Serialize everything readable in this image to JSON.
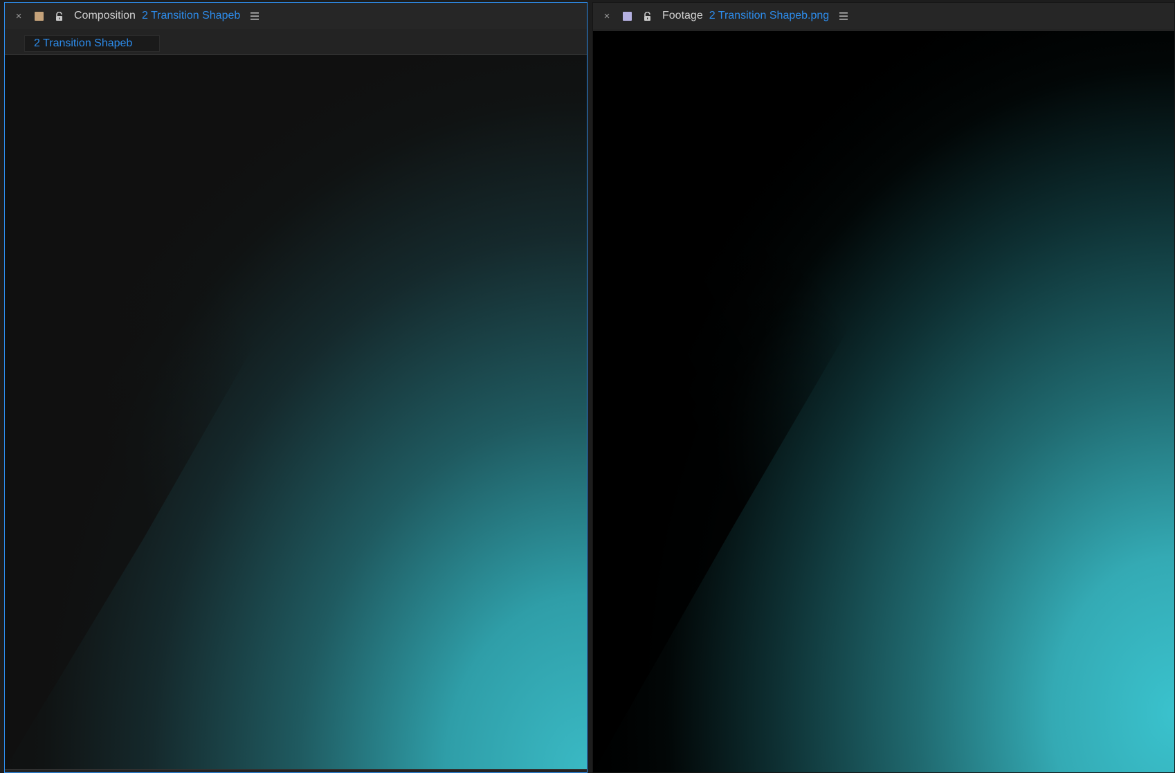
{
  "composition_panel": {
    "panel_type": "Composition",
    "name": "2 Transition Shapeb",
    "label_color": "#c4a27a",
    "breadcrumb": "2 Transition Shapeb",
    "viewer_background": "#101010"
  },
  "footage_panel": {
    "panel_type": "Footage",
    "name": "2 Transition Shapeb.png",
    "label_color": "#b4b0e0",
    "viewer_background": "#000000"
  },
  "icons": {
    "close": "close-icon",
    "lock": "lock-icon",
    "menu": "menu-icon"
  },
  "colors": {
    "accent": "#2d8ceb",
    "gradient_teal": "#3ab9c4"
  }
}
